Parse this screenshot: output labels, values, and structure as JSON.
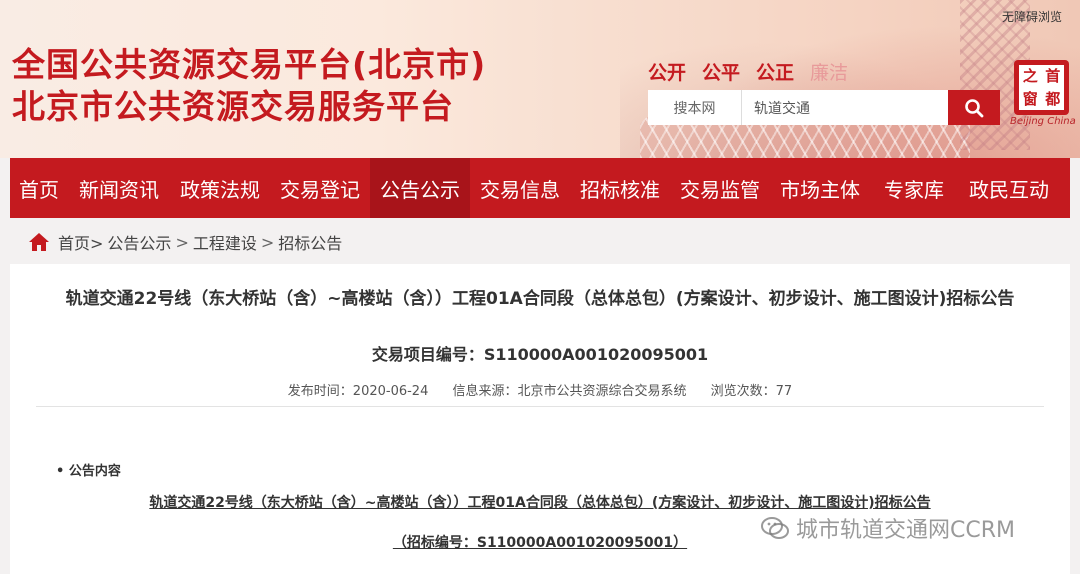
{
  "header": {
    "title_line1": "全国公共资源交易平台(北京市)",
    "title_line2": "北京市公共资源交易服务平台",
    "accessibility_link": "无障碍浏览",
    "mottos": [
      "公开",
      "公平",
      "公正",
      "廉洁"
    ],
    "search": {
      "scope_label": "搜本网",
      "query_value": "轨道交通",
      "button_icon": "search-icon"
    },
    "logo": {
      "seal_chars": [
        "首",
        "都",
        "之",
        "窗"
      ],
      "caption": "Beijing China"
    }
  },
  "nav": {
    "items": [
      {
        "label": "首页",
        "active": false
      },
      {
        "label": "新闻资讯",
        "active": false
      },
      {
        "label": "政策法规",
        "active": false
      },
      {
        "label": "交易登记",
        "active": false
      },
      {
        "label": "公告公示",
        "active": true
      },
      {
        "label": "交易信息",
        "active": false
      },
      {
        "label": "招标核准",
        "active": false
      },
      {
        "label": "交易监管",
        "active": false
      },
      {
        "label": "市场主体",
        "active": false
      },
      {
        "label": "专家库",
        "active": false
      },
      {
        "label": "政民互动",
        "active": false
      }
    ]
  },
  "breadcrumb": {
    "icon": "home-icon",
    "items": [
      "首页>",
      "公告公示",
      "工程建设",
      "招标公告"
    ],
    "separator": ">"
  },
  "article": {
    "title": "轨道交通22号线（东大桥站（含）~高楼站（含））工程01A合同段（总体总包）(方案设计、初步设计、施工图设计)招标公告",
    "project_code": "交易项目编号：S110000A001020095001",
    "meta": {
      "publish_time": "发布时间：2020-06-24",
      "source": "信息来源：北京市公共资源综合交易系统",
      "views": "浏览次数：77"
    },
    "section_heading": "• 公告内容",
    "body_title": "轨道交通22号线（东大桥站（含）~高楼站（含））工程01A合同段（总体总包）(方案设计、初步设计、施工图设计)招标公告",
    "body_code": "（招标编号：S110000A001020095001）"
  },
  "watermark": {
    "icon": "wechat-icon",
    "text": "城市轨道交通网CCRM"
  },
  "colors": {
    "brand_red": "#c41a1f",
    "nav_active": "#a8141a"
  }
}
